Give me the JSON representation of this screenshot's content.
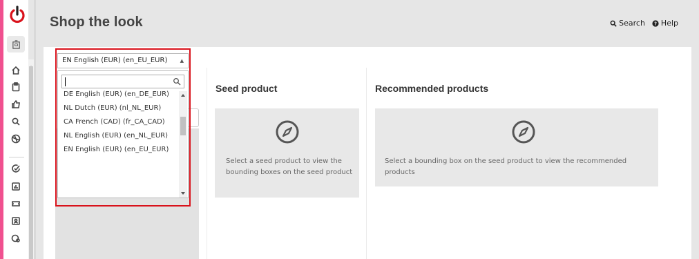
{
  "header": {
    "title": "Shop the look",
    "search_label": "Search",
    "help_label": "Help"
  },
  "locale_select": {
    "selected": "EN English (EUR) (en_EU_EUR)",
    "search_value": "",
    "options": [
      "DE English (EUR) (en_DE_EUR)",
      "NL Dutch (EUR) (nl_NL_EUR)",
      "CA French (CAD) (fr_CA_CAD)",
      "NL English (EUR) (en_NL_EUR)",
      "EN English (EUR) (en_EU_EUR)"
    ]
  },
  "seed_product": {
    "title": "Seed product",
    "message": "Select a seed product to view the bounding boxes on the seed product"
  },
  "recommended_products": {
    "title": "Recommended products",
    "message": "Select a bounding box on the seed product to view the recommended products"
  },
  "sidebar": {
    "icons": [
      "power-icon",
      "building-icon",
      "home-icon",
      "clipboard-icon",
      "thumbs-up-icon",
      "search-icon",
      "globe-icon",
      "check-badge-icon",
      "chart-icon",
      "ticket-icon",
      "id-card-icon",
      "settings-icon"
    ]
  },
  "colors": {
    "accent_pink": "#f0508f",
    "power_red": "#d9121b",
    "highlight_border": "#d9121b"
  }
}
